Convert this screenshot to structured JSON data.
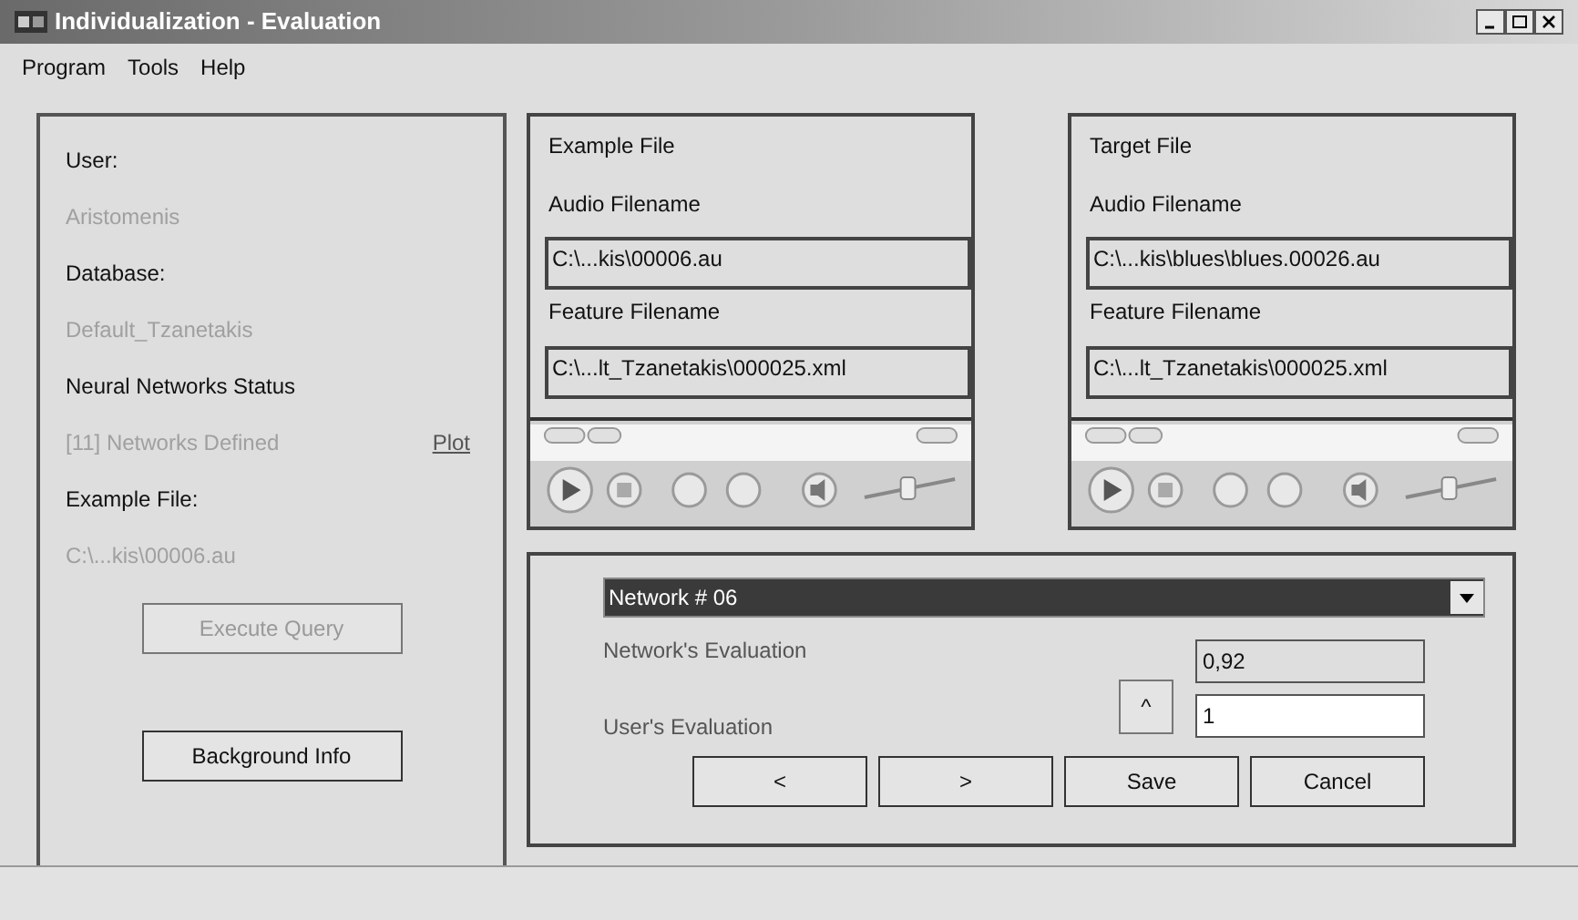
{
  "window": {
    "title": "Individualization - Evaluation"
  },
  "menu": [
    "Program",
    "Tools",
    "Help"
  ],
  "left_panel": {
    "fields": [
      {
        "label": "User:",
        "value": "Aristomenis"
      },
      {
        "label": "Database:",
        "value": "Default_Tzanetakis"
      },
      {
        "label": "Neural Networks Status",
        "value": "[11] Networks Defined",
        "link": "Plot"
      },
      {
        "label": "Example File:",
        "value": "C:\\...kis\\00006.au"
      }
    ],
    "buttons": [
      {
        "label": "Execute Query",
        "disabled": true
      },
      {
        "label": "Background Info",
        "disabled": false
      }
    ]
  },
  "file_panels": [
    {
      "title": "Example File",
      "audio_label": "Audio Filename",
      "audio_value": "C:\\...kis\\00006.au",
      "feature_label": "Feature Filename",
      "feature_value": "C:\\...lt_Tzanetakis\\000025.xml"
    },
    {
      "title": "Target File",
      "audio_label": "Audio Filename",
      "audio_value": "C:\\...kis\\blues\\blues.00026.au",
      "feature_label": "Feature Filename",
      "feature_value": "C:\\...lt_Tzanetakis\\000025.xml"
    }
  ],
  "evaluation": {
    "network": "Network # 06",
    "network_eval_label": "Network's Evaluation",
    "network_eval_value": "0,92",
    "user_eval_label": "User's Evaluation",
    "user_eval_value": "1",
    "spin": "^",
    "buttons": [
      "<",
      ">",
      "Save",
      "Cancel"
    ]
  }
}
